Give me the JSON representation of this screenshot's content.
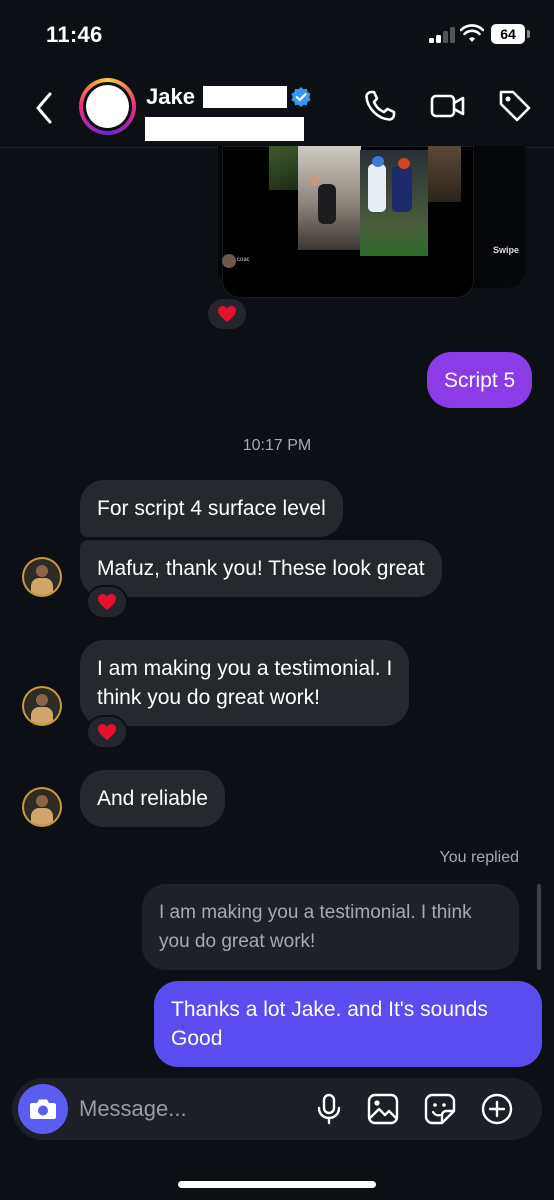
{
  "status_bar": {
    "time": "11:46",
    "battery": "64"
  },
  "header": {
    "contact_name": "Jake"
  },
  "post": {
    "coach_label": "coac",
    "swipe_label": "Swipe"
  },
  "messages": {
    "outgoing_1": "Script 5",
    "timestamp": "10:17 PM",
    "incoming_1": "For script 4 surface level",
    "incoming_2": "Mafuz, thank you! These look great",
    "incoming_3_line1": "I am making you a testimonial. I",
    "incoming_3_line2": "think you do great work!",
    "incoming_4": "And reliable",
    "you_replied": "You replied",
    "quoted_line1": "I am making you a testimonial. I think",
    "quoted_line2": "you do great work!",
    "outgoing_2_line1": "Thanks a lot Jake. and It's sounds",
    "outgoing_2_line2": "Good"
  },
  "composer": {
    "placeholder": "Message..."
  },
  "colors": {
    "accent": "#5b5cf0",
    "outgoing_purple": "#8c3ce6",
    "outgoing_blue": "#5b4cf0",
    "verified": "#3897f0",
    "heart": "#e8112d"
  }
}
